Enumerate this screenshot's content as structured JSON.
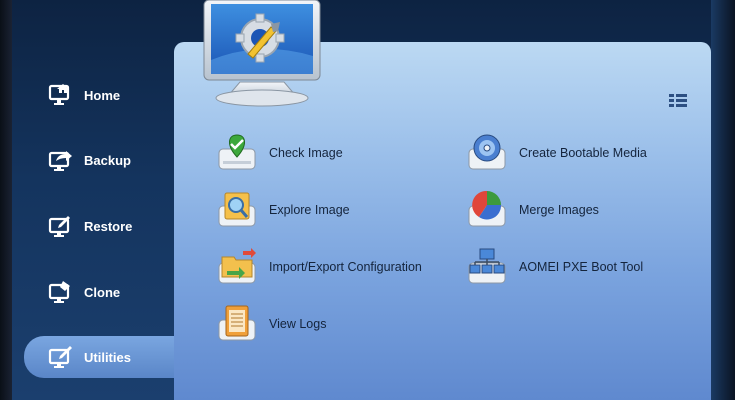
{
  "sidebar": {
    "items": [
      {
        "label": "Home",
        "icon": "home-icon"
      },
      {
        "label": "Backup",
        "icon": "backup-icon"
      },
      {
        "label": "Restore",
        "icon": "restore-icon"
      },
      {
        "label": "Clone",
        "icon": "clone-icon"
      },
      {
        "label": "Utilities",
        "icon": "utilities-icon",
        "active": true
      }
    ]
  },
  "tools": {
    "check_image": "Check Image",
    "explore_image": "Explore Image",
    "import_export": "Import/Export Configuration",
    "view_logs": "View Logs",
    "create_bootable": "Create Bootable Media",
    "merge_images": "Merge Images",
    "pxe_boot": "AOMEI PXE Boot Tool"
  },
  "colors": {
    "background": "#14345e",
    "panel_top": "#bcd9f3",
    "panel_bottom": "#5f89cf",
    "active_nav": "#6b97d6"
  }
}
